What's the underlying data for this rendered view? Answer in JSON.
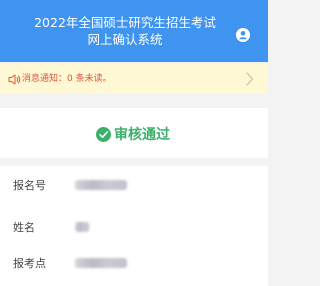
{
  "header": {
    "title_line1": "2022年全国硕士研究生招生考试",
    "title_line2": "网上确认系统",
    "user_icon": "user-circle-icon",
    "background": "#3e94ee"
  },
  "notice": {
    "text": "消息通知：0 条未读。",
    "icon": "speaker-icon",
    "arrow_icon": "chevron-right-icon",
    "background": "#fff8d5",
    "text_color": "#e5543a"
  },
  "status": {
    "text": "审核通过",
    "icon": "check-circle-icon",
    "color": "#3bb06b"
  },
  "info": {
    "rows": [
      {
        "label": "报名号"
      },
      {
        "label": "姓名"
      },
      {
        "label": "报考点"
      }
    ]
  }
}
